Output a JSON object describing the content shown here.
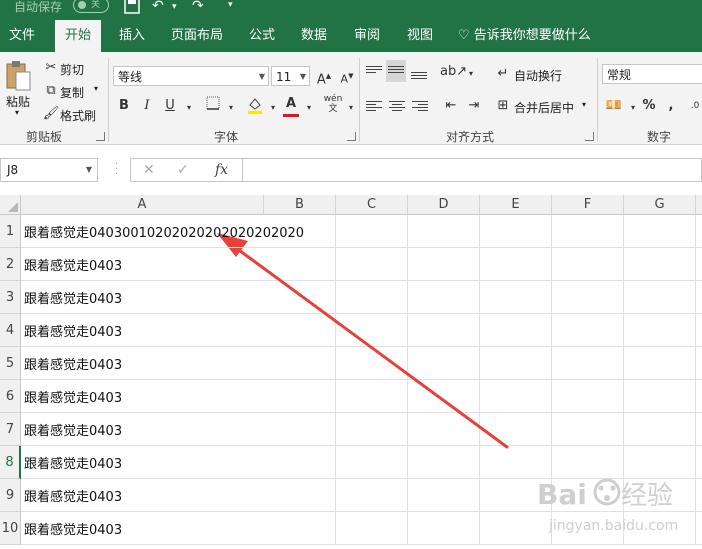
{
  "titlebar": {
    "autosave_label": "自动保存",
    "autosave_state": "关"
  },
  "tabs": [
    {
      "label": "文件",
      "active": false
    },
    {
      "label": "开始",
      "active": true
    },
    {
      "label": "插入",
      "active": false
    },
    {
      "label": "页面布局",
      "active": false
    },
    {
      "label": "公式",
      "active": false
    },
    {
      "label": "数据",
      "active": false
    },
    {
      "label": "审阅",
      "active": false
    },
    {
      "label": "视图",
      "active": false
    }
  ],
  "tell_me": "告诉我你想要做什么",
  "ribbon": {
    "clipboard": {
      "paste": "粘贴",
      "cut": "剪切",
      "copy": "复制",
      "format_painter": "格式刷",
      "group_label": "剪贴板"
    },
    "font": {
      "font_name": "等线",
      "font_size": "11",
      "bold": "B",
      "italic": "I",
      "underline": "U",
      "group_label": "字体"
    },
    "alignment": {
      "wrap_text": "自动换行",
      "merge_center": "合并后居中",
      "group_label": "对齐方式"
    },
    "number": {
      "format": "常规",
      "percent": "%",
      "comma": ",",
      "group_label": "数字"
    }
  },
  "formula_bar": {
    "name_box": "J8",
    "cancel": "✕",
    "enter": "✓",
    "fx": "fx",
    "content": ""
  },
  "grid": {
    "columns": [
      "A",
      "B",
      "C",
      "D",
      "E",
      "F",
      "G"
    ],
    "rows": [
      {
        "num": "1",
        "a": "跟着感觉走04030010202020202020202020"
      },
      {
        "num": "2",
        "a": "跟着感觉走0403"
      },
      {
        "num": "3",
        "a": "跟着感觉走0403"
      },
      {
        "num": "4",
        "a": "跟着感觉走0403"
      },
      {
        "num": "5",
        "a": "跟着感觉走0403"
      },
      {
        "num": "6",
        "a": "跟着感觉走0403"
      },
      {
        "num": "7",
        "a": "跟着感觉走0403"
      },
      {
        "num": "8",
        "a": "跟着感觉走0403"
      },
      {
        "num": "9",
        "a": "跟着感觉走0403"
      },
      {
        "num": "10",
        "a": "跟着感觉走0403"
      }
    ],
    "selected_row": "8"
  },
  "colors": {
    "excel_green": "#217346",
    "arrow_red": "#e8403a"
  }
}
